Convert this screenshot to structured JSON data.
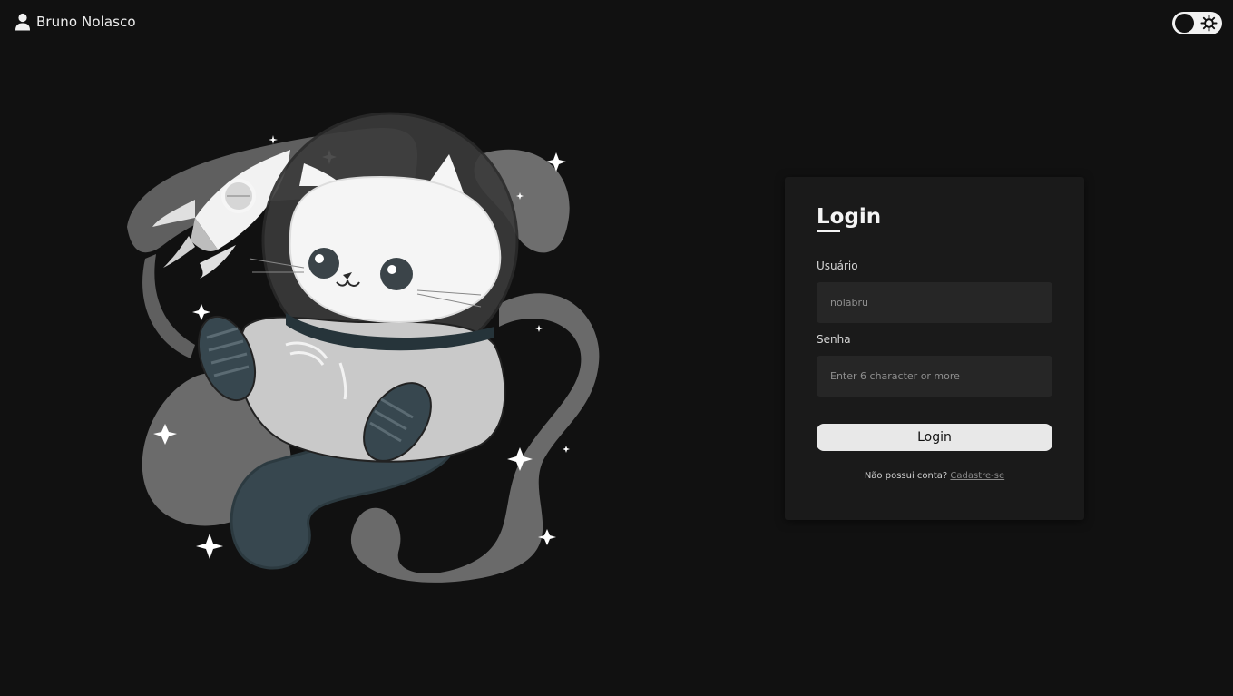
{
  "header": {
    "user_name": "Bruno Nolasco",
    "theme_toggle_icon": "sun-icon"
  },
  "login": {
    "title": "Login",
    "username_label": "Usuário",
    "username_placeholder": "nolabru",
    "password_label": "Senha",
    "password_placeholder": "Enter 6 character or more",
    "submit_label": "Login",
    "signup_prompt": "Não possui conta?",
    "signup_link": "Cadastre-se"
  },
  "illustration": {
    "subject": "astronaut-cat-with-rocket",
    "colors": {
      "background": "#111111",
      "swirl": "#6b6b6b",
      "cat": "#f5f5f5",
      "suit": "#c9c9c9",
      "accent": "#37474f"
    }
  },
  "colors": {
    "page_background": "#111111",
    "card_background": "#1a1a1a",
    "input_background": "#262626",
    "button_background": "#e8e8e8",
    "text": "#e6e6e6"
  }
}
